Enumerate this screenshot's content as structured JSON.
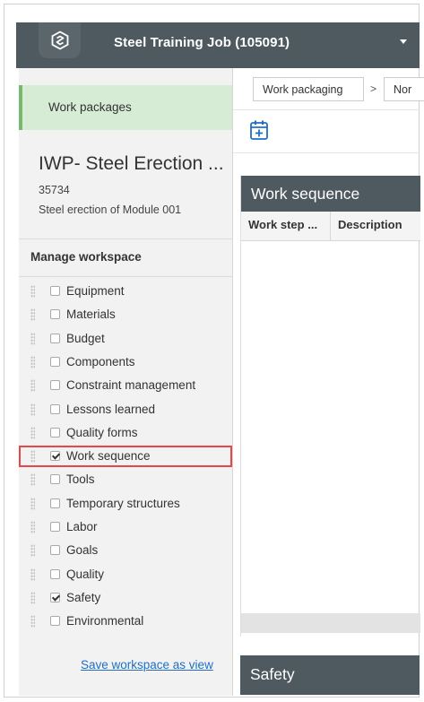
{
  "header": {
    "project_name": "Steel Training Job (105091)",
    "logo_icon": "app-logo-icon",
    "dropdown_icon": "caret-down-icon"
  },
  "sidebar": {
    "active_tab": "Work packages",
    "package_title": "IWP- Steel Erection ...",
    "package_id": "35734",
    "package_description": "Steel erection of Module 001",
    "workspace_heading": "Manage workspace",
    "items": [
      {
        "label": "Equipment",
        "checked": false,
        "highlighted": false
      },
      {
        "label": "Materials",
        "checked": false,
        "highlighted": false
      },
      {
        "label": "Budget",
        "checked": false,
        "highlighted": false
      },
      {
        "label": "Components",
        "checked": false,
        "highlighted": false
      },
      {
        "label": "Constraint management",
        "checked": false,
        "highlighted": false
      },
      {
        "label": "Lessons learned",
        "checked": false,
        "highlighted": false
      },
      {
        "label": "Quality forms",
        "checked": false,
        "highlighted": false
      },
      {
        "label": "Work sequence",
        "checked": true,
        "highlighted": true
      },
      {
        "label": "Tools",
        "checked": false,
        "highlighted": false
      },
      {
        "label": "Temporary structures",
        "checked": false,
        "highlighted": false
      },
      {
        "label": "Labor",
        "checked": false,
        "highlighted": false
      },
      {
        "label": "Goals",
        "checked": false,
        "highlighted": false
      },
      {
        "label": "Quality",
        "checked": false,
        "highlighted": false
      },
      {
        "label": "Safety",
        "checked": true,
        "highlighted": false
      },
      {
        "label": "Environmental",
        "checked": false,
        "highlighted": false
      }
    ],
    "save_link": "Save workspace as view"
  },
  "breadcrumb": {
    "first": "Work packaging",
    "separator": ">",
    "second": "Nor"
  },
  "toolbar": {
    "calendar_icon": "calendar-add-icon"
  },
  "work_sequence": {
    "title": "Work sequence",
    "columns": [
      "Work step ...",
      "Description"
    ]
  },
  "safety": {
    "title": "Safety"
  },
  "colors": {
    "header_bg": "#4e5a60",
    "active_tab_bg": "#d6ecd4",
    "highlight_border": "#e44848",
    "link": "#1f6fc4",
    "calendar_icon": "#1f6fc4"
  }
}
